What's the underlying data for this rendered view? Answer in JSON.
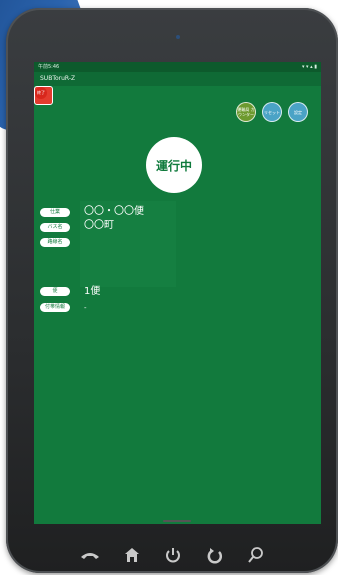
{
  "status_bar": {
    "left": "午前5:46",
    "right": "▾ ▾ ▴ ▮"
  },
  "app": {
    "title": "SUBToruR-Z"
  },
  "buttons": {
    "end": "終了",
    "contact": "運輸局 カウンター",
    "reset": "リセット",
    "settings": "設定"
  },
  "status": {
    "label": "運行中"
  },
  "info": {
    "labels": {
      "operation": "仕業",
      "bus_name": "バス名",
      "route_name": "路線名",
      "trip": "便",
      "extra": "付帯情報"
    },
    "values": {
      "operation": "〇〇・〇〇便",
      "bus_name": "〇〇町",
      "route_name": "",
      "trip": "1便",
      "extra": "-"
    }
  },
  "nav_icons": [
    "phone-icon",
    "home-icon",
    "power-icon",
    "back-icon",
    "search-icon"
  ]
}
